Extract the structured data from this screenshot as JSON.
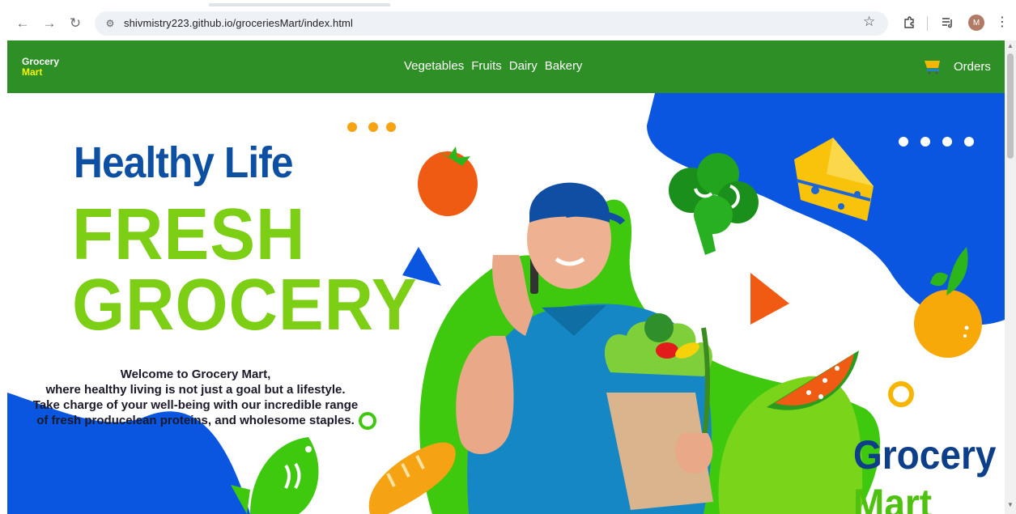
{
  "browser": {
    "url": "shivmistry223.github.io/groceriesMart/index.html",
    "profile_initial": "M",
    "icons": [
      "back-icon",
      "forward-icon",
      "reload-icon",
      "site-info-icon",
      "bookmark-star-icon",
      "extensions-icon",
      "media-controls-icon",
      "kebab-menu-icon"
    ]
  },
  "site": {
    "logo": {
      "line1": "Grocery",
      "line2": "Mart"
    },
    "nav": [
      "Vegetables",
      "Fruits",
      "Dairy",
      "Bakery"
    ],
    "orders_label": "Orders",
    "cart_icon": "cart-icon"
  },
  "hero": {
    "headline_1": "Healthy Life",
    "headline_2": "FRESH",
    "headline_3": "GROCERY",
    "welcome_lines": [
      "Welcome to Grocery Mart,",
      "where healthy living is not just a goal but a lifestyle.",
      "Take charge of your well-being with our incredible range",
      "of fresh producelean proteins, and wholesome staples."
    ],
    "brand_1": "Grocery",
    "brand_2": "Mart"
  },
  "colors": {
    "nav_green": "#2d8f25",
    "logo_yellow": "#f5f20b",
    "headline_blue": "#0d4fa3",
    "fresh_green": "#7ccf14",
    "blob_blue": "#0a56e0"
  }
}
